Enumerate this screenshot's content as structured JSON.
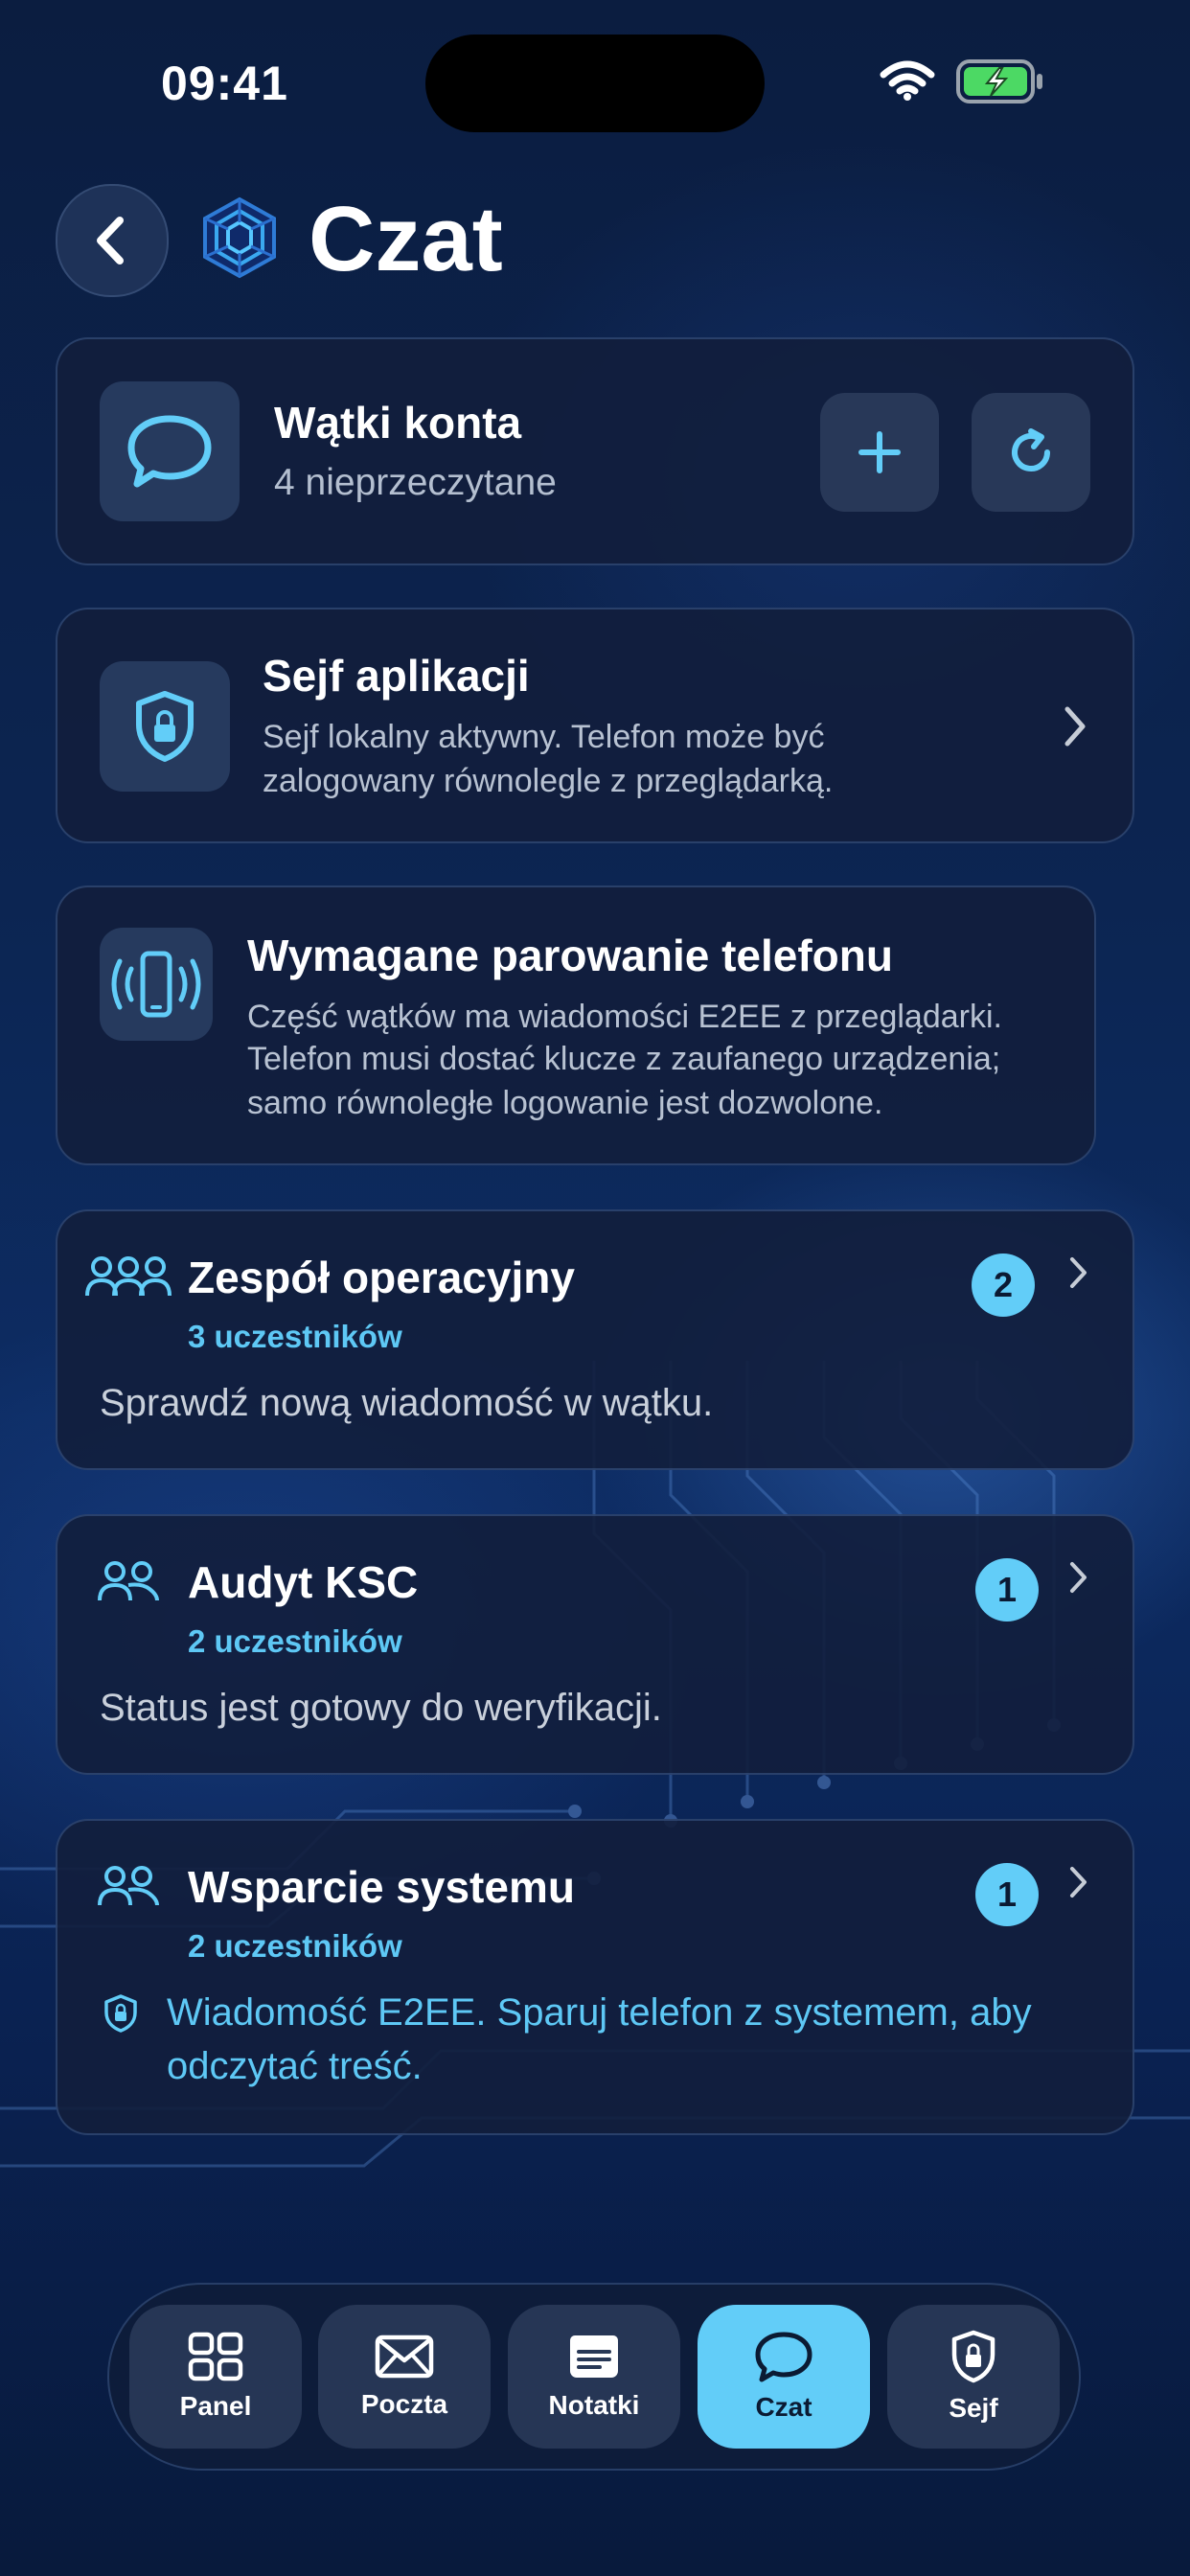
{
  "status_bar": {
    "time": "09:41"
  },
  "header": {
    "title": "Czat"
  },
  "threads_card": {
    "title": "Wątki konta",
    "subtitle": "4 nieprzeczytane"
  },
  "vault_card": {
    "title": "Sejf aplikacji",
    "line1": "Sejf lokalny aktywny. Telefon może być",
    "line2": "zalogowany równolegle z przeglądarką."
  },
  "pairing_card": {
    "title": "Wymagane parowanie telefonu",
    "line1": "Część wątków ma wiadomości E2EE z przeglądarki.",
    "line2": "Telefon musi dostać klucze z zaufanego urządzenia;",
    "line3": "samo równoległe logowanie jest dozwolone."
  },
  "threads": [
    {
      "name": "Zespół operacyjny",
      "participants": "3 uczestników",
      "unread": "2",
      "preview": "Sprawdź nową wiadomość w wątku."
    },
    {
      "name": "Audyt KSC",
      "participants": "2 uczestników",
      "unread": "1",
      "preview": "Status jest gotowy do weryfikacji."
    },
    {
      "name": "Wsparcie systemu",
      "participants": "2 uczestników",
      "unread": "1",
      "preview_line1": "Wiadomość E2EE. Sparuj telefon z systemem, aby",
      "preview_line2": "odczytać treść."
    }
  ],
  "tabbar": {
    "tabs": [
      {
        "label": "Panel",
        "icon": "grid-icon"
      },
      {
        "label": "Poczta",
        "icon": "envelope-icon"
      },
      {
        "label": "Notatki",
        "icon": "note-icon"
      },
      {
        "label": "Czat",
        "icon": "chat-bubble-icon",
        "active": true
      },
      {
        "label": "Sejf",
        "icon": "shield-lock-icon"
      }
    ]
  },
  "colors": {
    "accent": "#62cdf8",
    "card": "#121e3c",
    "background": "#0c2552"
  }
}
